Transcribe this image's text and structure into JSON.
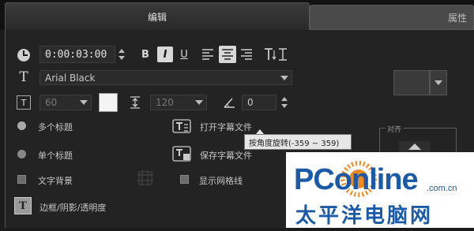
{
  "tabs": {
    "edit": "编辑",
    "properties": "属性"
  },
  "time": {
    "value": "0:00:03:00"
  },
  "format": {
    "bold": "B",
    "italic": "I",
    "underline": "U"
  },
  "font": {
    "name": "Arial Black",
    "size": "60",
    "line_spacing": "120",
    "angle": "0"
  },
  "options": {
    "multi_title": "多个标题",
    "single_title": "单个标题",
    "open_subtitle": "打开字幕文件",
    "save_subtitle": "保存字幕文件",
    "text_background": "文字背景",
    "show_grid": "显示网格线",
    "border_shadow": "边框/阴影/透明度"
  },
  "tooltip": "按角度旋转(-359 ~ 359)",
  "align_label": "对齐",
  "watermark": {
    "brand": "PConline",
    "domain": ".com.cn",
    "cn": "太平洋电脑网"
  },
  "colors": {
    "accent": "#1a5aa8",
    "orange": "#f08a1c"
  }
}
